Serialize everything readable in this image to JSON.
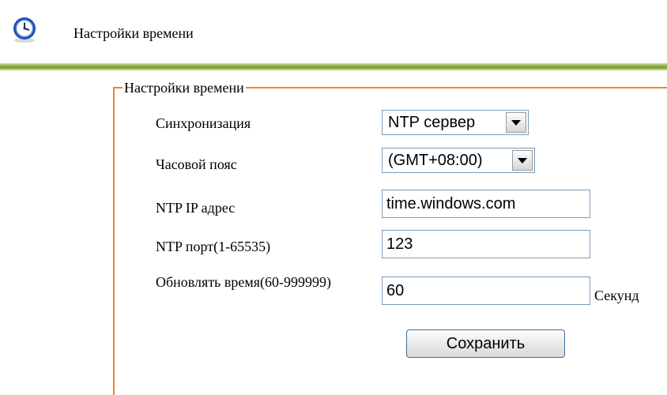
{
  "header": {
    "title": "Настройки времени",
    "icon": "clock-icon"
  },
  "form": {
    "legend": "Настройки времени",
    "sync": {
      "label": "Синхронизация",
      "value": "NTP сервер"
    },
    "timezone": {
      "label": "Часовой пояс",
      "value": "(GMT+08:00)"
    },
    "ntp_ip": {
      "label": "NTP IP адрес",
      "value": "time.windows.com"
    },
    "ntp_port": {
      "label": "NTP порт(1-65535)",
      "value": "123"
    },
    "update_interval": {
      "label": "Обновлять время(60-999999)",
      "value": "60",
      "unit": "Секунд"
    },
    "save_label": "Сохранить"
  },
  "colors": {
    "fieldset_border": "#f08a24",
    "divider": "#6f9a2c",
    "input_border": "#7a9bb8",
    "button_border": "#3d6ea4"
  }
}
